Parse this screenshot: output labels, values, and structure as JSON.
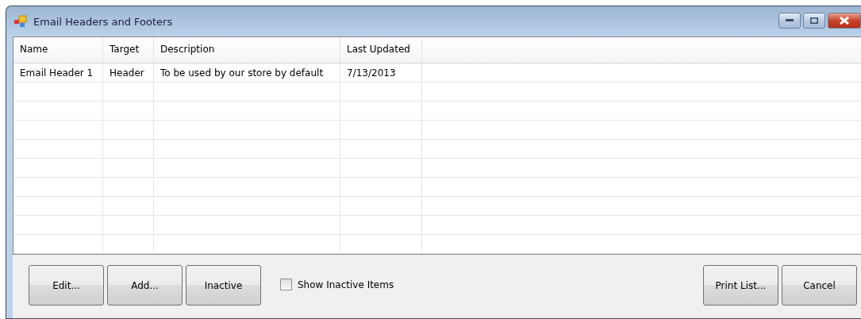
{
  "window": {
    "title": "Email Headers and Footers"
  },
  "table": {
    "columns": [
      "Name",
      "Target",
      "Description",
      "Last Updated"
    ],
    "rows": [
      {
        "cells": [
          "Email Header 1",
          "Header",
          "To be used by our store by default",
          "7/13/2013"
        ],
        "selected": false
      }
    ]
  },
  "buttons_left": [
    "Edit...",
    "Add...",
    "Inactive"
  ],
  "show_inactive": {
    "label": "Show Inactive Items",
    "checked": false
  },
  "buttons_right": [
    "Print List...",
    "Cancel"
  ]
}
